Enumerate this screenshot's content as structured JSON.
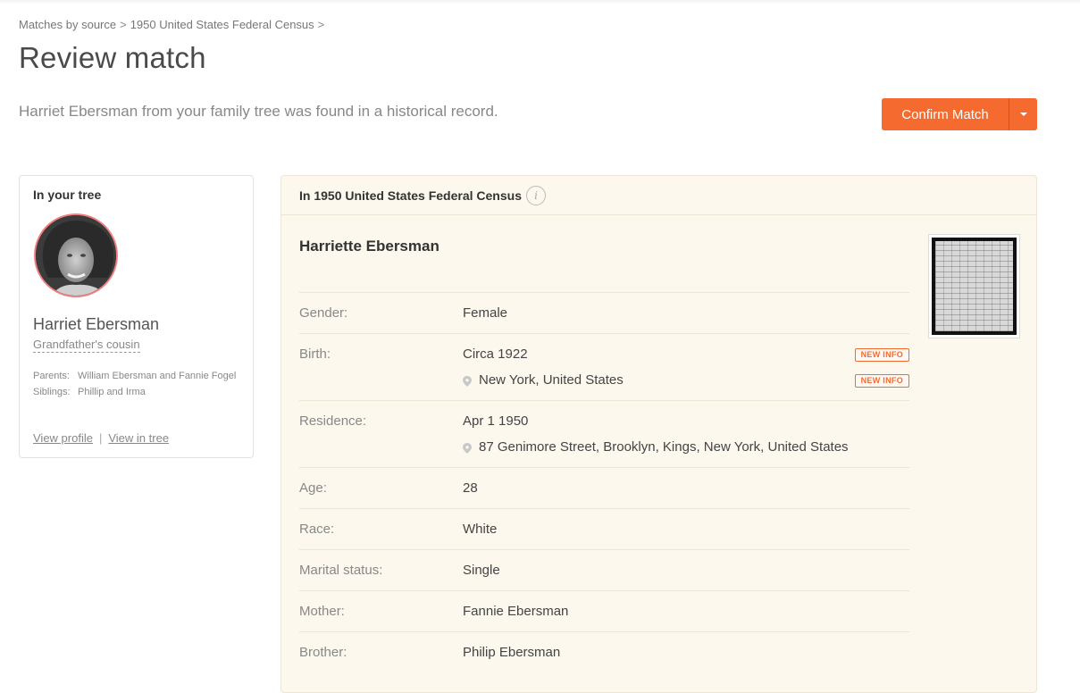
{
  "breadcrumb": {
    "items": [
      "Matches by source",
      "1950 United States Federal Census"
    ],
    "separator": ">"
  },
  "page": {
    "title": "Review match",
    "subtitle": "Harriet Ebersman from your family tree was found in a historical record."
  },
  "actions": {
    "confirm_label": "Confirm Match",
    "dropdown_icon": "caret-down-icon",
    "accent_color": "#f56a2e"
  },
  "tree": {
    "title": "In your tree",
    "name": "Harriet Ebersman",
    "relation": "Grandfather's cousin",
    "facts": [
      {
        "label": "Parents:",
        "value": "William Ebersman and Fannie Fogel"
      },
      {
        "label": "Siblings:",
        "value": "Phillip and Irma"
      }
    ],
    "links": {
      "view_profile": "View profile",
      "view_in_tree": "View in tree"
    }
  },
  "record": {
    "title": "In 1950 United States Federal Census",
    "info_icon": "i",
    "name": "Harriette Ebersman",
    "new_badge": "NEW INFO",
    "fields": [
      {
        "label": "Gender:",
        "lines": [
          {
            "text": "Female",
            "pin": false,
            "new": false
          }
        ]
      },
      {
        "label": "Birth:",
        "lines": [
          {
            "text": "Circa 1922",
            "pin": false,
            "new": true
          },
          {
            "text": "New York, United States",
            "pin": true,
            "new": true
          }
        ]
      },
      {
        "label": "Residence:",
        "lines": [
          {
            "text": "Apr 1 1950",
            "pin": false,
            "new": false
          },
          {
            "text": "87 Genimore Street, Brooklyn, Kings, New York, United States",
            "pin": true,
            "new": false
          }
        ]
      },
      {
        "label": "Age:",
        "lines": [
          {
            "text": "28",
            "pin": false,
            "new": false
          }
        ]
      },
      {
        "label": "Race:",
        "lines": [
          {
            "text": "White",
            "pin": false,
            "new": false
          }
        ]
      },
      {
        "label": "Marital status:",
        "lines": [
          {
            "text": "Single",
            "pin": false,
            "new": false
          }
        ]
      },
      {
        "label": "Mother:",
        "lines": [
          {
            "text": "Fannie Ebersman",
            "pin": false,
            "new": false
          }
        ]
      },
      {
        "label": "Brother:",
        "lines": [
          {
            "text": "Philip Ebersman",
            "pin": false,
            "new": false
          }
        ]
      }
    ]
  }
}
